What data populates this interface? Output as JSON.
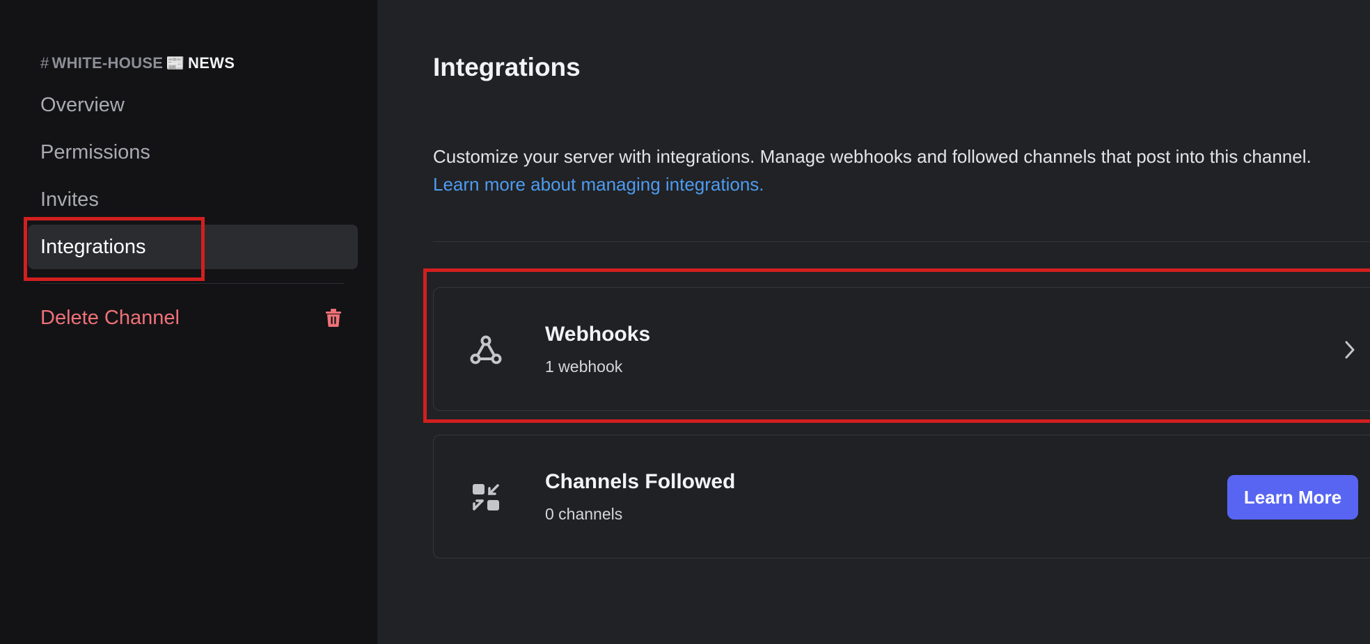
{
  "sidebar": {
    "channel_hash": "#",
    "channel_name": "WHITE-HOUSE",
    "channel_emoji": "📰",
    "channel_suffix": "NEWS",
    "items": [
      {
        "label": "Overview"
      },
      {
        "label": "Permissions"
      },
      {
        "label": "Invites"
      },
      {
        "label": "Integrations",
        "active": true
      }
    ],
    "delete_label": "Delete Channel"
  },
  "main": {
    "title": "Integrations",
    "description": "Customize your server with integrations. Manage webhooks and followed channels that post into this channel.",
    "learn_link": "Learn more about managing integrations.",
    "cards": [
      {
        "title": "Webhooks",
        "subtitle": "1 webhook",
        "icon": "webhook-icon"
      },
      {
        "title": "Channels Followed",
        "subtitle": "0 channels",
        "icon": "channel-follow-icon",
        "button_label": "Learn More"
      }
    ]
  },
  "colors": {
    "accent": "#5865f2",
    "link": "#4e9bf0",
    "danger": "#f07177",
    "highlight": "#d21f1f"
  }
}
